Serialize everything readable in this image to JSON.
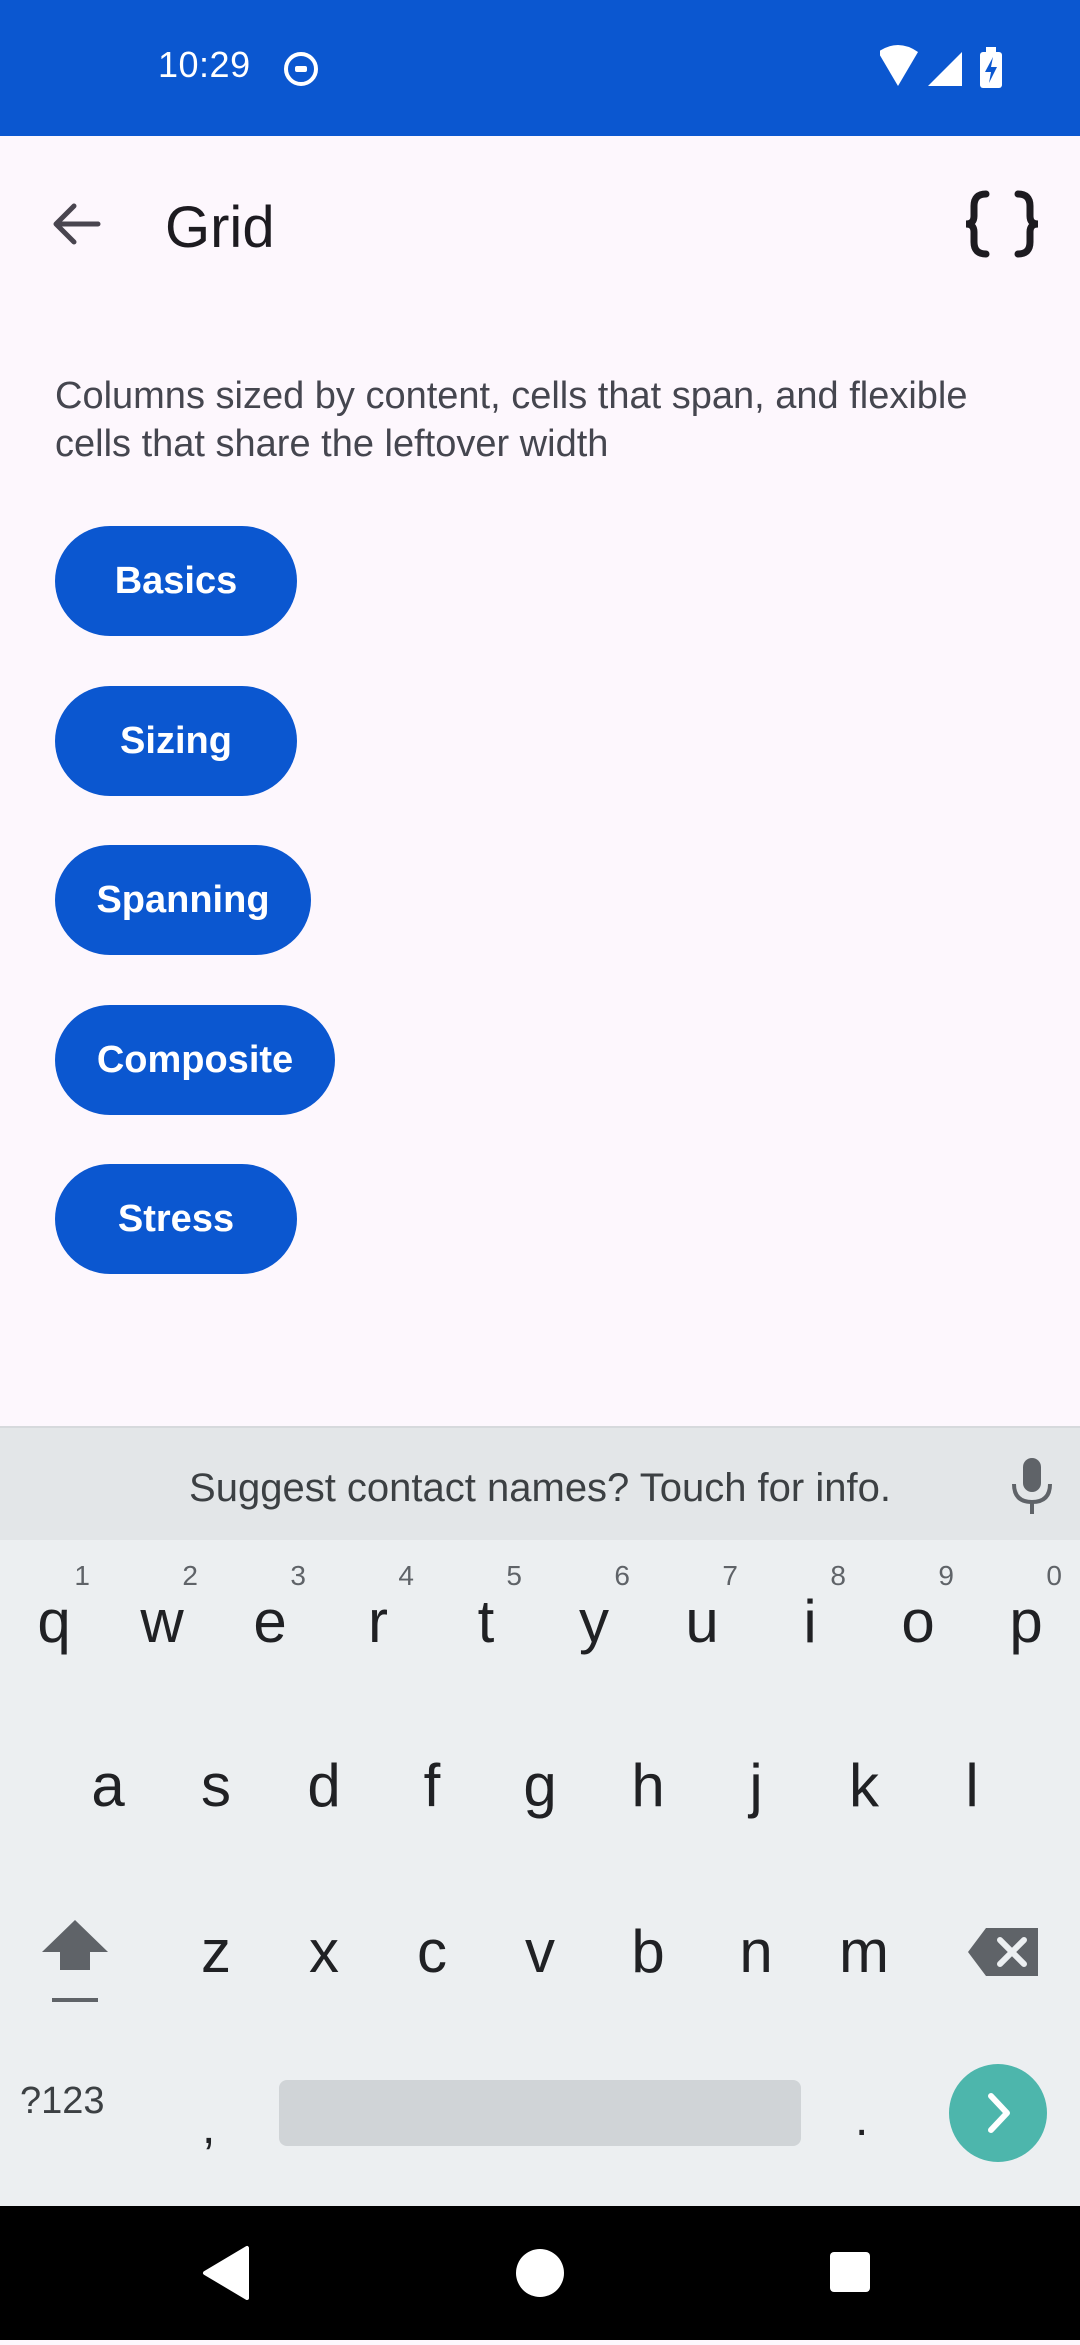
{
  "status_bar": {
    "time": "10:29",
    "icons": [
      "notification-icon",
      "wifi-icon",
      "cell-signal-icon",
      "battery-charging-icon"
    ]
  },
  "app_bar": {
    "title": "Grid",
    "back_icon": "arrow-back-icon",
    "code_icon": "code-braces-icon"
  },
  "description": "Columns sized by content, cells that span, and flexible cells that share the leftover width",
  "buttons": [
    {
      "label": "Basics"
    },
    {
      "label": "Sizing"
    },
    {
      "label": "Spanning"
    },
    {
      "label": "Composite"
    },
    {
      "label": "Stress"
    }
  ],
  "keyboard": {
    "suggestion": "Suggest contact names? Touch for info.",
    "row1": [
      {
        "key": "q",
        "hint": "1"
      },
      {
        "key": "w",
        "hint": "2"
      },
      {
        "key": "e",
        "hint": "3"
      },
      {
        "key": "r",
        "hint": "4"
      },
      {
        "key": "t",
        "hint": "5"
      },
      {
        "key": "y",
        "hint": "6"
      },
      {
        "key": "u",
        "hint": "7"
      },
      {
        "key": "i",
        "hint": "8"
      },
      {
        "key": "o",
        "hint": "9"
      },
      {
        "key": "p",
        "hint": "0"
      }
    ],
    "row2": [
      "a",
      "s",
      "d",
      "f",
      "g",
      "h",
      "j",
      "k",
      "l"
    ],
    "row3": [
      "z",
      "x",
      "c",
      "v",
      "b",
      "n",
      "m"
    ],
    "symbols_label": "?123",
    "comma": ",",
    "period": "."
  },
  "colors": {
    "primary": "#0b57d0",
    "background": "#fdf7fd",
    "keyboard_bg": "#eceff1",
    "enter": "#4db6ac"
  }
}
